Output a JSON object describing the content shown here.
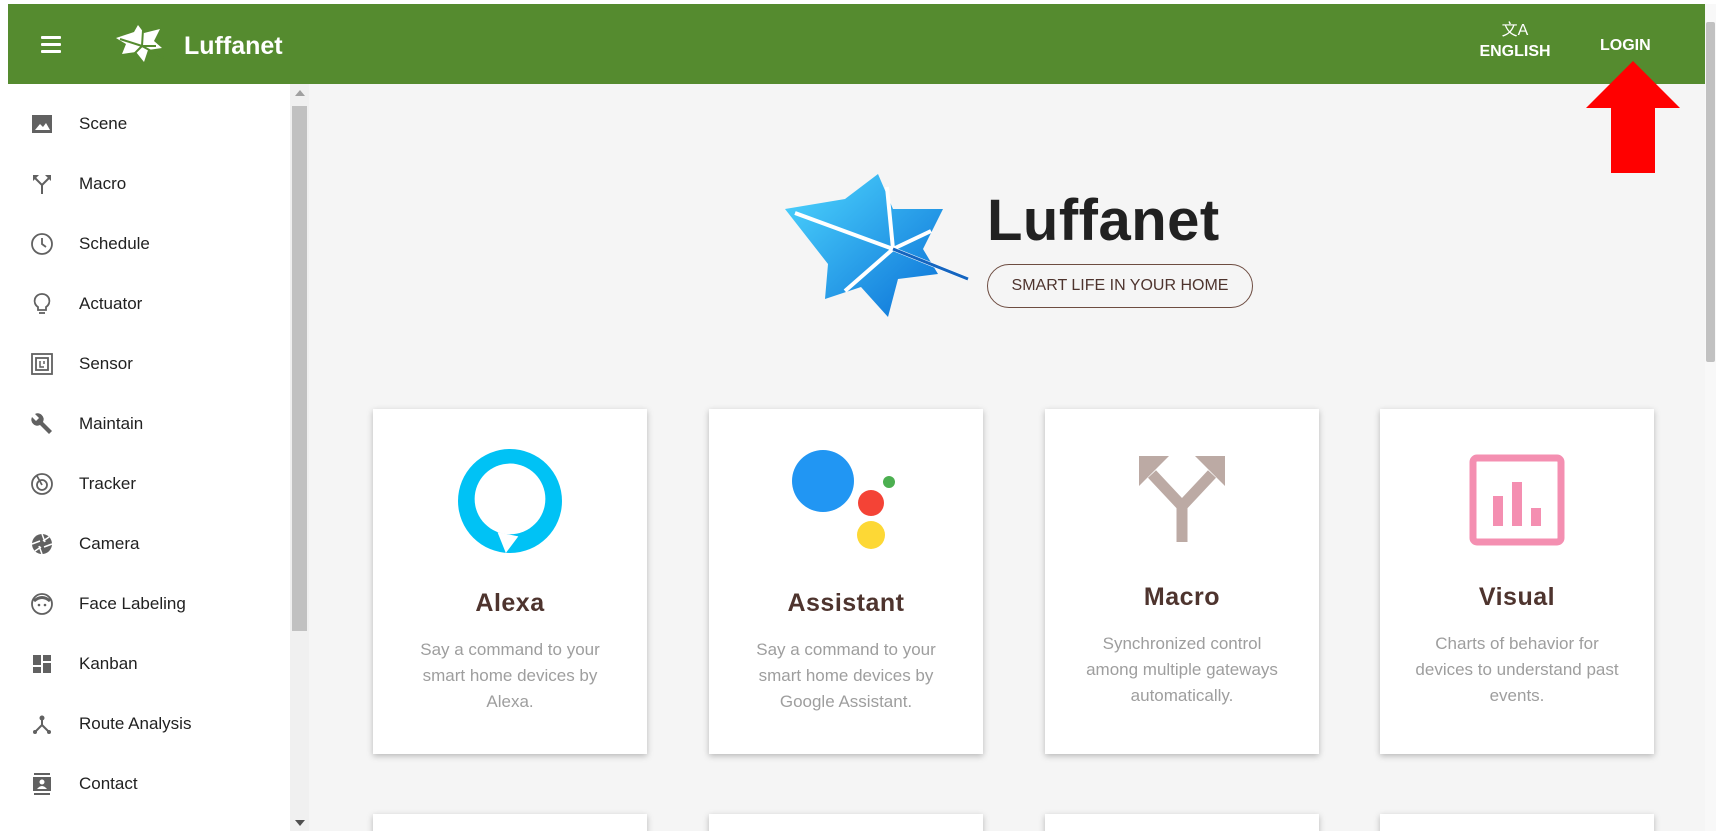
{
  "colors": {
    "header": "#558b2f",
    "accent_red": "#ff0000",
    "card_title": "#4e342e"
  },
  "header": {
    "brand": "Luffanet",
    "menu_icon": "hamburger-icon",
    "language_icon": "translate-icon",
    "language_label": "ENGLISH",
    "login_label": "LOGIN"
  },
  "sidebar": {
    "items": [
      {
        "label": "Scene",
        "icon": "image-icon"
      },
      {
        "label": "Macro",
        "icon": "split-arrows-icon"
      },
      {
        "label": "Schedule",
        "icon": "clock-icon"
      },
      {
        "label": "Actuator",
        "icon": "lightbulb-icon"
      },
      {
        "label": "Sensor",
        "icon": "sensor-icon"
      },
      {
        "label": "Maintain",
        "icon": "wrench-icon"
      },
      {
        "label": "Tracker",
        "icon": "radar-icon"
      },
      {
        "label": "Camera",
        "icon": "aperture-icon"
      },
      {
        "label": "Face Labeling",
        "icon": "face-icon"
      },
      {
        "label": "Kanban",
        "icon": "dashboard-icon"
      },
      {
        "label": "Route Analysis",
        "icon": "route-icon"
      },
      {
        "label": "Contact",
        "icon": "contact-icon"
      }
    ]
  },
  "hero": {
    "title": "Luffanet",
    "tagline": "SMART LIFE IN YOUR HOME"
  },
  "cards": [
    {
      "title": "Alexa",
      "desc": "Say a command to your smart home devices by Alexa.",
      "icon": "alexa-icon"
    },
    {
      "title": "Assistant",
      "desc": "Say a command to your smart home devices by Google Assistant.",
      "icon": "google-assistant-icon"
    },
    {
      "title": "Macro",
      "desc": "Synchronized control among multiple gateways automatically.",
      "icon": "split-arrows-icon"
    },
    {
      "title": "Visual",
      "desc": "Charts of behavior for devices to understand past events.",
      "icon": "bar-chart-icon"
    }
  ]
}
